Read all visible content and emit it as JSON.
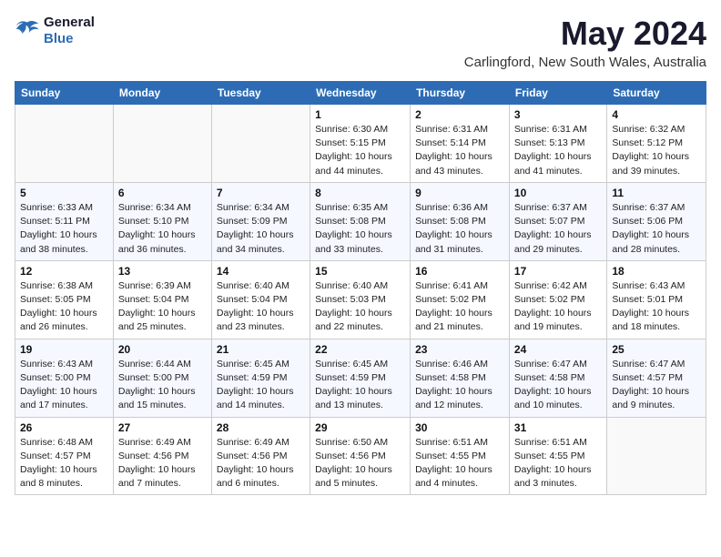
{
  "app": {
    "logo_line1": "General",
    "logo_line2": "Blue",
    "title": "May 2024",
    "subtitle": "Carlingford, New South Wales, Australia"
  },
  "calendar": {
    "headers": [
      "Sunday",
      "Monday",
      "Tuesday",
      "Wednesday",
      "Thursday",
      "Friday",
      "Saturday"
    ],
    "rows": [
      [
        {
          "day": "",
          "info": ""
        },
        {
          "day": "",
          "info": ""
        },
        {
          "day": "",
          "info": ""
        },
        {
          "day": "1",
          "info": "Sunrise: 6:30 AM\nSunset: 5:15 PM\nDaylight: 10 hours\nand 44 minutes."
        },
        {
          "day": "2",
          "info": "Sunrise: 6:31 AM\nSunset: 5:14 PM\nDaylight: 10 hours\nand 43 minutes."
        },
        {
          "day": "3",
          "info": "Sunrise: 6:31 AM\nSunset: 5:13 PM\nDaylight: 10 hours\nand 41 minutes."
        },
        {
          "day": "4",
          "info": "Sunrise: 6:32 AM\nSunset: 5:12 PM\nDaylight: 10 hours\nand 39 minutes."
        }
      ],
      [
        {
          "day": "5",
          "info": "Sunrise: 6:33 AM\nSunset: 5:11 PM\nDaylight: 10 hours\nand 38 minutes."
        },
        {
          "day": "6",
          "info": "Sunrise: 6:34 AM\nSunset: 5:10 PM\nDaylight: 10 hours\nand 36 minutes."
        },
        {
          "day": "7",
          "info": "Sunrise: 6:34 AM\nSunset: 5:09 PM\nDaylight: 10 hours\nand 34 minutes."
        },
        {
          "day": "8",
          "info": "Sunrise: 6:35 AM\nSunset: 5:08 PM\nDaylight: 10 hours\nand 33 minutes."
        },
        {
          "day": "9",
          "info": "Sunrise: 6:36 AM\nSunset: 5:08 PM\nDaylight: 10 hours\nand 31 minutes."
        },
        {
          "day": "10",
          "info": "Sunrise: 6:37 AM\nSunset: 5:07 PM\nDaylight: 10 hours\nand 29 minutes."
        },
        {
          "day": "11",
          "info": "Sunrise: 6:37 AM\nSunset: 5:06 PM\nDaylight: 10 hours\nand 28 minutes."
        }
      ],
      [
        {
          "day": "12",
          "info": "Sunrise: 6:38 AM\nSunset: 5:05 PM\nDaylight: 10 hours\nand 26 minutes."
        },
        {
          "day": "13",
          "info": "Sunrise: 6:39 AM\nSunset: 5:04 PM\nDaylight: 10 hours\nand 25 minutes."
        },
        {
          "day": "14",
          "info": "Sunrise: 6:40 AM\nSunset: 5:04 PM\nDaylight: 10 hours\nand 23 minutes."
        },
        {
          "day": "15",
          "info": "Sunrise: 6:40 AM\nSunset: 5:03 PM\nDaylight: 10 hours\nand 22 minutes."
        },
        {
          "day": "16",
          "info": "Sunrise: 6:41 AM\nSunset: 5:02 PM\nDaylight: 10 hours\nand 21 minutes."
        },
        {
          "day": "17",
          "info": "Sunrise: 6:42 AM\nSunset: 5:02 PM\nDaylight: 10 hours\nand 19 minutes."
        },
        {
          "day": "18",
          "info": "Sunrise: 6:43 AM\nSunset: 5:01 PM\nDaylight: 10 hours\nand 18 minutes."
        }
      ],
      [
        {
          "day": "19",
          "info": "Sunrise: 6:43 AM\nSunset: 5:00 PM\nDaylight: 10 hours\nand 17 minutes."
        },
        {
          "day": "20",
          "info": "Sunrise: 6:44 AM\nSunset: 5:00 PM\nDaylight: 10 hours\nand 15 minutes."
        },
        {
          "day": "21",
          "info": "Sunrise: 6:45 AM\nSunset: 4:59 PM\nDaylight: 10 hours\nand 14 minutes."
        },
        {
          "day": "22",
          "info": "Sunrise: 6:45 AM\nSunset: 4:59 PM\nDaylight: 10 hours\nand 13 minutes."
        },
        {
          "day": "23",
          "info": "Sunrise: 6:46 AM\nSunset: 4:58 PM\nDaylight: 10 hours\nand 12 minutes."
        },
        {
          "day": "24",
          "info": "Sunrise: 6:47 AM\nSunset: 4:58 PM\nDaylight: 10 hours\nand 10 minutes."
        },
        {
          "day": "25",
          "info": "Sunrise: 6:47 AM\nSunset: 4:57 PM\nDaylight: 10 hours\nand 9 minutes."
        }
      ],
      [
        {
          "day": "26",
          "info": "Sunrise: 6:48 AM\nSunset: 4:57 PM\nDaylight: 10 hours\nand 8 minutes."
        },
        {
          "day": "27",
          "info": "Sunrise: 6:49 AM\nSunset: 4:56 PM\nDaylight: 10 hours\nand 7 minutes."
        },
        {
          "day": "28",
          "info": "Sunrise: 6:49 AM\nSunset: 4:56 PM\nDaylight: 10 hours\nand 6 minutes."
        },
        {
          "day": "29",
          "info": "Sunrise: 6:50 AM\nSunset: 4:56 PM\nDaylight: 10 hours\nand 5 minutes."
        },
        {
          "day": "30",
          "info": "Sunrise: 6:51 AM\nSunset: 4:55 PM\nDaylight: 10 hours\nand 4 minutes."
        },
        {
          "day": "31",
          "info": "Sunrise: 6:51 AM\nSunset: 4:55 PM\nDaylight: 10 hours\nand 3 minutes."
        },
        {
          "day": "",
          "info": ""
        }
      ]
    ]
  }
}
